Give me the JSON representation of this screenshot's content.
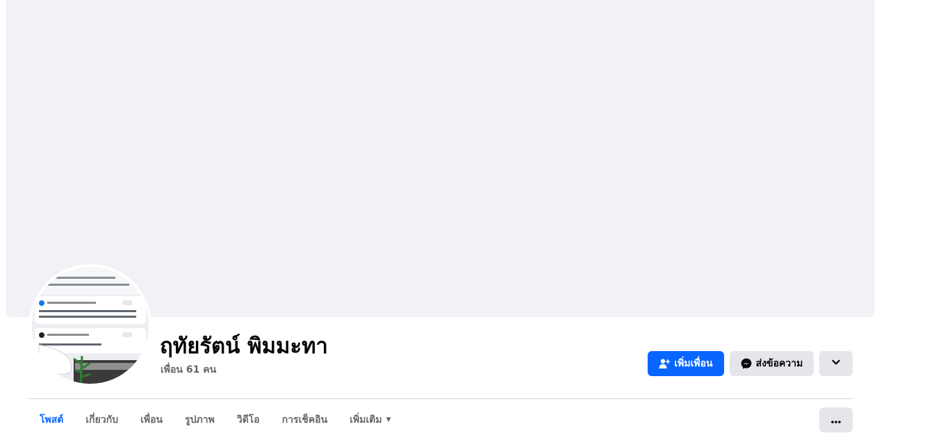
{
  "profile": {
    "name": "ฤทัยรัตน์ พิมมะทา",
    "friends": "เพื่อน 61 คน"
  },
  "actions": {
    "add_friend": "เพิ่มเพื่อน",
    "message": "ส่งข้อความ"
  },
  "tabs": [
    {
      "label": "โพสต์"
    },
    {
      "label": "เกี่ยวกับ"
    },
    {
      "label": "เพื่อน"
    },
    {
      "label": "รูปภาพ"
    },
    {
      "label": "วิดีโอ"
    },
    {
      "label": "การเช็คอิน"
    },
    {
      "label": "เพิ่มเติม"
    }
  ],
  "icons": {
    "add_friend": "person-plus-icon",
    "message": "messenger-icon",
    "expand": "chevron-down-icon",
    "more": "ellipsis-icon",
    "tab_more_caret": "caret-down-icon"
  },
  "colors": {
    "accent": "#0866ff",
    "secondary_bg": "#e4e6eb",
    "cover_bg": "#f0f2f5",
    "muted_text": "#65676b"
  }
}
